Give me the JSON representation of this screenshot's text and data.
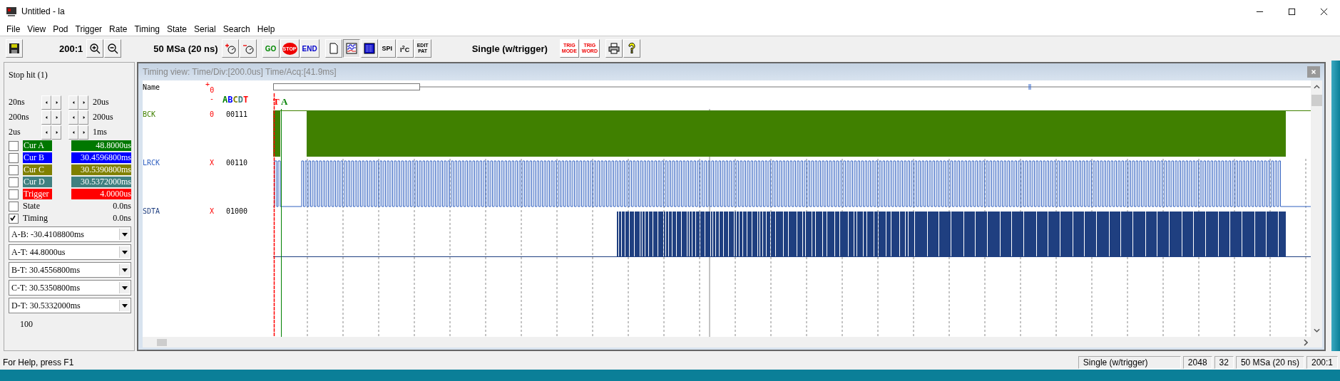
{
  "window": {
    "title": "Untitled - la"
  },
  "menu": [
    "File",
    "View",
    "Pod",
    "Trigger",
    "Rate",
    "Timing",
    "State",
    "Serial",
    "Search",
    "Help"
  ],
  "toolbar": {
    "ratio": "200:1",
    "rate": "50 MSa  (20 ns)",
    "go": "GO",
    "stop": "STOP",
    "end": "END",
    "spi": "SPI",
    "i2c": "I$^{2}$C",
    "edit_pat": [
      "EDIT",
      "PAT"
    ],
    "mode": "Single (w/trigger)",
    "trig_mode": [
      "TRIG",
      "MODE"
    ],
    "trig_word": [
      "TRIG",
      "WORD"
    ]
  },
  "panel": {
    "status": "Stop hit (1)",
    "steppers": [
      {
        "left": "20ns",
        "right": "20us"
      },
      {
        "left": "200ns",
        "right": "200us"
      },
      {
        "left": "2us",
        "right": "1ms"
      }
    ],
    "cursors": [
      {
        "kind": "colored",
        "label": "Cur A",
        "value": "48.8000us",
        "color": "#007800",
        "checked": false
      },
      {
        "kind": "colored",
        "label": "Cur B",
        "value": "30.4596800ms",
        "color": "#0000ff",
        "checked": false
      },
      {
        "kind": "colored",
        "label": "Cur C",
        "value": "30.5390800ms",
        "color": "#808000",
        "checked": false
      },
      {
        "kind": "colored",
        "label": "Cur D",
        "value": "30.5372000ms",
        "color": "#408080",
        "checked": false
      },
      {
        "kind": "colored",
        "label": "Trigger",
        "value": "4.0000us",
        "color": "#ff0000",
        "checked": false
      },
      {
        "kind": "plain",
        "label": "State",
        "value": "0.0ns",
        "checked": false
      },
      {
        "kind": "plain",
        "label": "Timing",
        "value": "0.0ns",
        "checked": true
      }
    ],
    "deltas": [
      "A-B: -30.4108800ms",
      "A-T: 44.8000us",
      "B-T: 30.4556800ms",
      "C-T: 30.5350800ms",
      "D-T: 30.5332000ms"
    ],
    "count": "100"
  },
  "view": {
    "title": "Timing view:  Time/Div:[200.0us] Time/Acq:[41.9ms]",
    "name_header": "Name",
    "plus": "+",
    "zero": "0",
    "minus": "-",
    "letters": [
      {
        "label": "A",
        "color": "#008000"
      },
      {
        "label": "B",
        "color": "#0000ff"
      },
      {
        "label": "C",
        "color": "#808000"
      },
      {
        "label": "D",
        "color": "#408080"
      },
      {
        "label": "T",
        "color": "#ff0000"
      }
    ],
    "markers": [
      {
        "label": "T",
        "color": "#ff0000"
      },
      {
        "label": "A",
        "color": "#008000"
      }
    ],
    "channels": [
      {
        "name": "BCK",
        "polarity": "0",
        "value": "00111",
        "kind": "solid",
        "color": "#408000"
      },
      {
        "name": "LRCK",
        "polarity": "X",
        "value": "00110",
        "kind": "clock",
        "color": "#3060c0"
      },
      {
        "name": "SDTA",
        "polarity": "X",
        "value": "01000",
        "kind": "data",
        "color": "#1f3f80"
      }
    ]
  },
  "status_bar": {
    "help": "For Help, press F1",
    "mode": "Single (w/trigger)",
    "samples": "2048",
    "channels": "32",
    "rate": "50 MSa  (20 ns)",
    "ratio": "200:1"
  }
}
